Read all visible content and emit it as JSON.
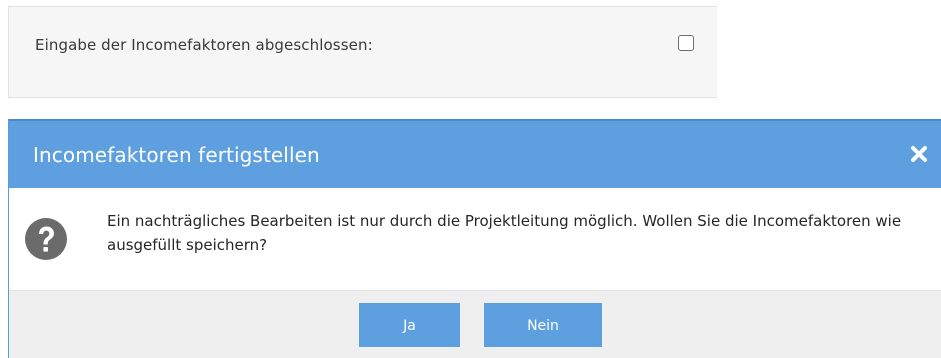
{
  "form": {
    "label": "Eingabe der Incomefaktoren abgeschlossen:",
    "checkbox_checked": false
  },
  "dialog": {
    "title": "Incomefaktoren fertigstellen",
    "close_icon": "close-icon",
    "question_icon": "question-icon",
    "message": "Ein nachträgliches Bearbeiten ist nur durch die Projektleitung möglich. Wollen Sie die Incomefaktoren wie ausgefüllt speichern?",
    "buttons": {
      "yes_label": "Ja",
      "no_label": "Nein"
    }
  },
  "colors": {
    "accent": "#5e9fe0",
    "icon_gray": "#6b6b6b",
    "footer_bg": "#efefef",
    "panel_bg": "#f6f6f6"
  }
}
